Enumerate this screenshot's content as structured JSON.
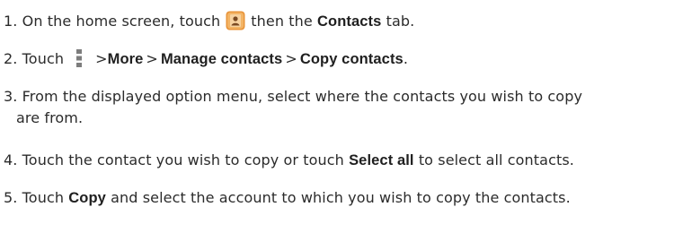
{
  "steps": [
    {
      "number": "1.",
      "text_a": "On the home screen, touch",
      "icon": "contacts-app-icon",
      "text_b": "then the",
      "bold_a": "Contacts",
      "text_c": "tab."
    },
    {
      "number": "2.",
      "text_a": "Touch",
      "icon": "menu-icon",
      "separator": ">",
      "path": [
        "More",
        "Manage contacts",
        "Copy contacts"
      ],
      "end": "."
    },
    {
      "number": "3.",
      "line1": "From the displayed option menu, select where the contacts you wish to copy",
      "line2": "are from."
    },
    {
      "number": "4.",
      "text_a": "Touch the contact you wish to copy or touch",
      "bold_a": "Select all",
      "text_b": "to select all contacts."
    },
    {
      "number": "5.",
      "text_a": "Touch",
      "bold_a": "Copy",
      "text_b": "and select the account to which you wish to copy the contacts."
    }
  ],
  "colors": {
    "text": "#2b2b2b",
    "icon_orange": "#e8943a",
    "icon_brown": "#7a4a22"
  }
}
